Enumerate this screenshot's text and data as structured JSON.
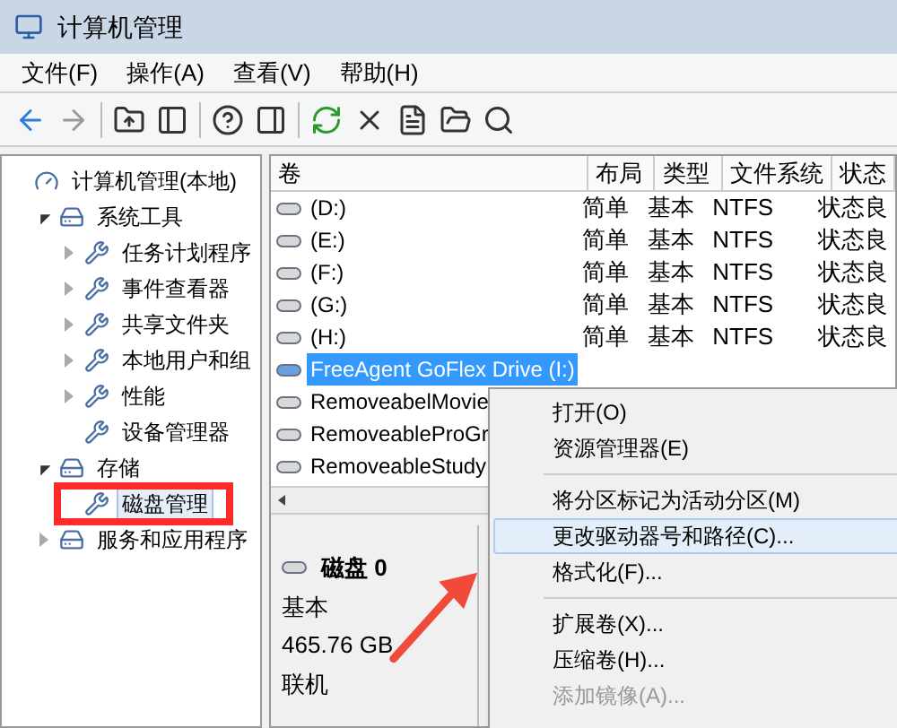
{
  "window": {
    "title": "计算机管理"
  },
  "menu_bar": [
    "文件(F)",
    "操作(A)",
    "查看(V)",
    "帮助(H)"
  ],
  "tree": [
    {
      "label": "计算机管理(本地)",
      "selected": false,
      "children": [
        {
          "label": "系统工具",
          "expanded": true,
          "selected": false,
          "children": [
            {
              "label": "任务计划程序",
              "expanded": false,
              "selected": false
            },
            {
              "label": "事件查看器",
              "expanded": false,
              "selected": false
            },
            {
              "label": "共享文件夹",
              "expanded": false,
              "selected": false
            },
            {
              "label": "本地用户和组",
              "expanded": false,
              "selected": false
            },
            {
              "label": "性能",
              "expanded": false,
              "selected": false
            },
            {
              "label": "设备管理器",
              "selected": false
            }
          ]
        },
        {
          "label": "存储",
          "expanded": true,
          "selected": false,
          "children": [
            {
              "label": "磁盘管理",
              "selected": true
            }
          ]
        },
        {
          "label": "服务和应用程序",
          "expanded": false,
          "selected": false
        }
      ]
    }
  ],
  "table": {
    "columns": [
      "卷",
      "布局",
      "类型",
      "文件系统",
      "状态"
    ],
    "rows": [
      {
        "name": "(D:)",
        "layout": "简单",
        "type": "基本",
        "fs": "NTFS",
        "status": "状态良",
        "selected": false
      },
      {
        "name": "(E:)",
        "layout": "简单",
        "type": "基本",
        "fs": "NTFS",
        "status": "状态良",
        "selected": false
      },
      {
        "name": "(F:)",
        "layout": "简单",
        "type": "基本",
        "fs": "NTFS",
        "status": "状态良",
        "selected": false
      },
      {
        "name": "(G:)",
        "layout": "简单",
        "type": "基本",
        "fs": "NTFS",
        "status": "状态良",
        "selected": false
      },
      {
        "name": "(H:)",
        "layout": "简单",
        "type": "基本",
        "fs": "NTFS",
        "status": "状态良",
        "selected": false
      },
      {
        "name": "FreeAgent GoFlex Drive (I:)",
        "selected": true
      },
      {
        "name": "RemoveabelMovie",
        "selected": false
      },
      {
        "name": "RemoveableProGr",
        "selected": false
      },
      {
        "name": "RemoveableStudy",
        "selected": false
      }
    ]
  },
  "disk": {
    "name": "磁盘 0",
    "type": "基本",
    "size": "465.76 GB",
    "status": "联机"
  },
  "context_menu": [
    {
      "kind": "item",
      "label": "打开(O)",
      "selected": false,
      "disabled": false
    },
    {
      "kind": "item",
      "label": "资源管理器(E)",
      "selected": false,
      "disabled": false
    },
    {
      "kind": "separator"
    },
    {
      "kind": "item",
      "label": "将分区标记为活动分区(M)",
      "selected": false,
      "disabled": false
    },
    {
      "kind": "item",
      "label": "更改驱动器号和路径(C)...",
      "selected": true,
      "disabled": false
    },
    {
      "kind": "item",
      "label": "格式化(F)...",
      "selected": false,
      "disabled": false
    },
    {
      "kind": "separator"
    },
    {
      "kind": "item",
      "label": "扩展卷(X)...",
      "selected": false,
      "disabled": false
    },
    {
      "kind": "item",
      "label": "压缩卷(H)...",
      "selected": false,
      "disabled": false
    },
    {
      "kind": "item",
      "label": "添加镜像(A)...",
      "selected": false,
      "disabled": true
    }
  ]
}
